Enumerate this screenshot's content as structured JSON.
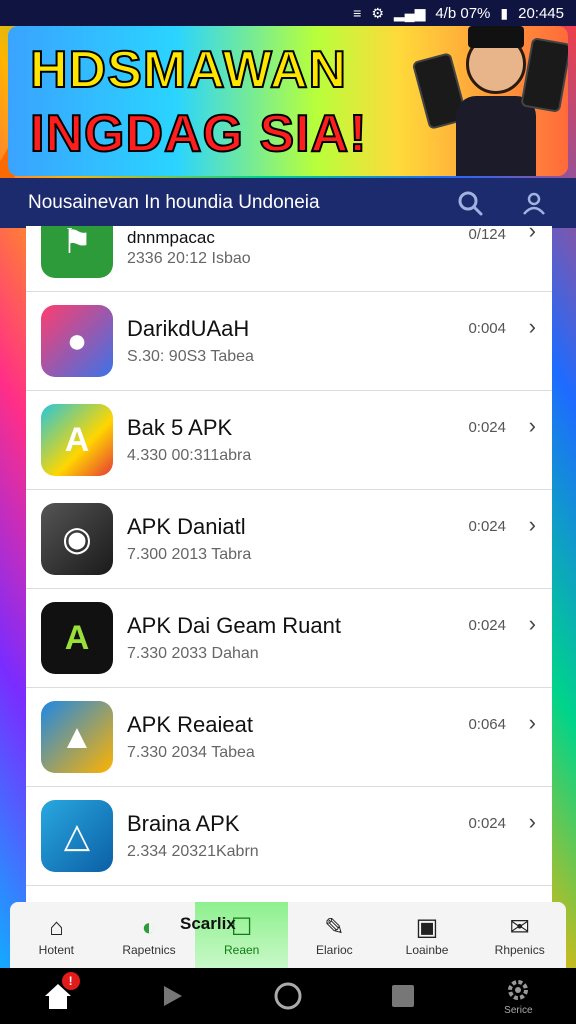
{
  "status_bar": {
    "network": "≡",
    "battery_text": "4/b 07%",
    "time": "20:445"
  },
  "banner": {
    "line1": "HDSMAWAN",
    "line2": "INGDAG SIA!"
  },
  "header": {
    "title": "Nousainevan In houndia Undoneia"
  },
  "apps": [
    {
      "name": "dnnmpacac",
      "meta": "2336 20:12 Isbao",
      "date": "0/124",
      "icon_bg": "#2e9b3a",
      "icon_text": "⚑"
    },
    {
      "name": "DarikdUAaH",
      "meta": "S.30: 90S3 Tabea",
      "date": "0:004",
      "icon_bg": "#3b73e8",
      "icon_text": "●"
    },
    {
      "name": "Bak 5 APK",
      "meta": "4.330 00:311abra",
      "date": "0:024",
      "icon_bg": "#26c6da",
      "icon_text": "A"
    },
    {
      "name": "APK Daniatl",
      "meta": "7.300 2013 Tabra",
      "date": "0:024",
      "icon_bg": "#2b2b2b",
      "icon_text": "◉"
    },
    {
      "name": "APK Dai Geam Ruant",
      "meta": "7.330 2033 Dahan",
      "date": "0:024",
      "icon_bg": "#111111",
      "icon_text": "A"
    },
    {
      "name": "APK Reaieat",
      "meta": "7.330 2034 Tabea",
      "date": "0:064",
      "icon_bg": "#1e88e5",
      "icon_text": "▲"
    },
    {
      "name": "Braina APK",
      "meta": "2.334 20321Kabrn",
      "date": "0:024",
      "icon_bg": "#29a8e0",
      "icon_text": "△"
    }
  ],
  "tabs": [
    {
      "label": "Hotent",
      "icon": "⌂"
    },
    {
      "label": "Rapetnics",
      "icon": "◐"
    },
    {
      "label": "Reaen",
      "icon": "☐"
    },
    {
      "label": "Elarioc",
      "icon": "✎"
    },
    {
      "label": "Loainbe",
      "icon": "▣"
    },
    {
      "label": "Rhpenics",
      "icon": "✉"
    }
  ],
  "tab_overlay": "Scarlix",
  "navbar": {
    "home_badge": "!",
    "settings_label": "Serice"
  },
  "colors": {
    "header_bg": "#1c2a6e",
    "active_tab": "#8ef08e",
    "badge": "#e21b1b"
  }
}
